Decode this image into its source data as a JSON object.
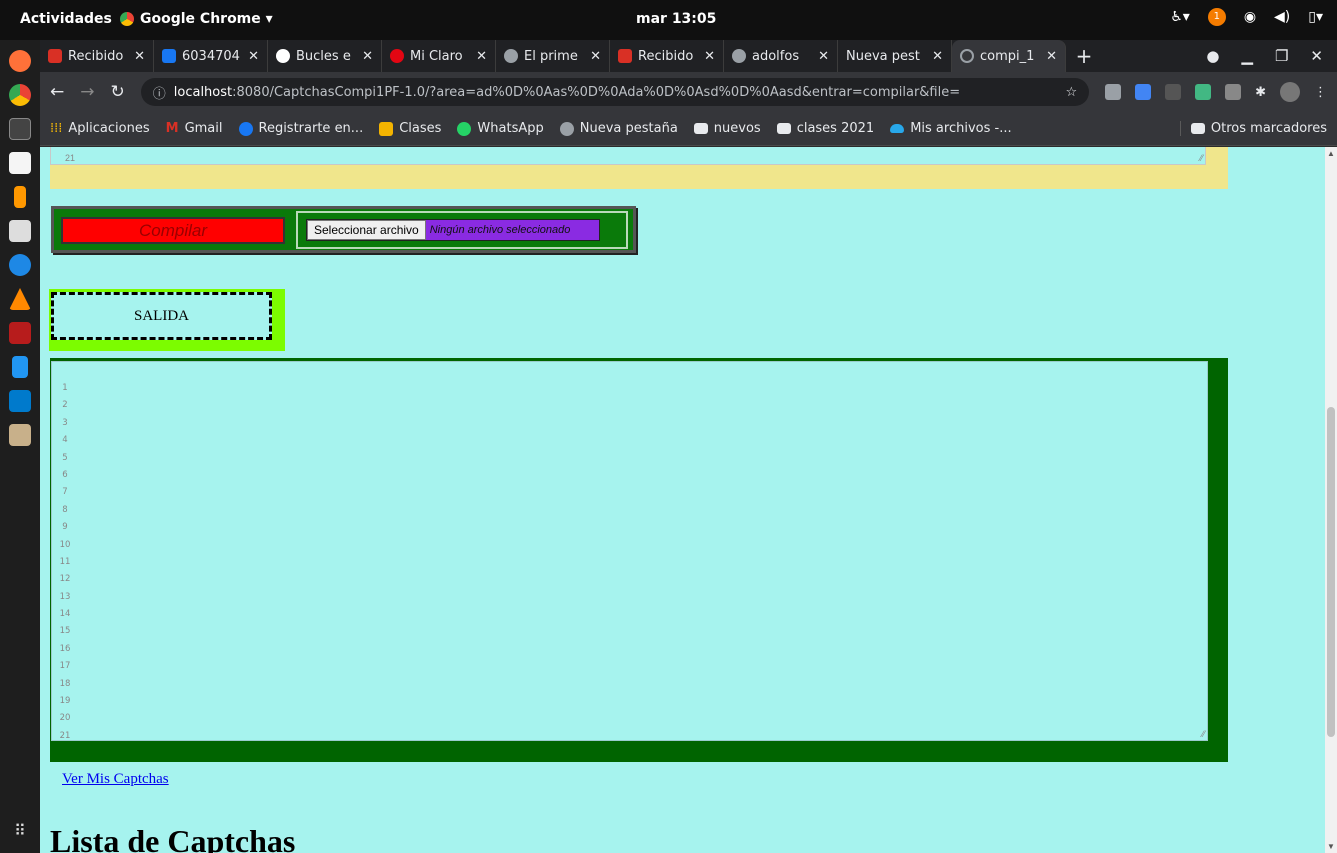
{
  "system": {
    "activities": "Actividades",
    "app_name": "Google Chrome ▾",
    "clock": "mar 13:05",
    "notification_count": "1"
  },
  "tabs": [
    {
      "label": "Recibido",
      "icon": "gmail-icon",
      "color": "#d93025"
    },
    {
      "label": "6034704",
      "icon": "facebook-icon",
      "color": "#1877f2"
    },
    {
      "label": "Bucles e",
      "icon": "pin-icon",
      "color": "#ffffff"
    },
    {
      "label": "Mi Claro",
      "icon": "claro-icon",
      "color": "#e30613"
    },
    {
      "label": "El prime",
      "icon": "globe-icon",
      "color": "#9aa0a6"
    },
    {
      "label": "Recibido",
      "icon": "gmail-icon",
      "color": "#d93025"
    },
    {
      "label": "adolfos",
      "icon": "github-icon",
      "color": "#9aa0a6"
    },
    {
      "label": "Nueva pest",
      "icon": "",
      "color": ""
    },
    {
      "label": "compi_1",
      "icon": "loading-icon",
      "color": "#9aa0a6",
      "active": true
    }
  ],
  "address": {
    "host": "localhost",
    "path": ":8080/CaptchasCompi1PF-1.0/?area=ad%0D%0Aas%0D%0Ada%0D%0Asd%0D%0Aasd&entrar=compilar&file="
  },
  "bookmarks": [
    {
      "label": "Aplicaciones",
      "icon": "apps-icon",
      "color": "#fbbc04"
    },
    {
      "label": "Gmail",
      "icon": "gmail-icon",
      "color": "#d93025"
    },
    {
      "label": "Registrarte en...",
      "icon": "facebook-icon",
      "color": "#1877f2"
    },
    {
      "label": "Clases",
      "icon": "classroom-icon",
      "color": "#f4b400"
    },
    {
      "label": "WhatsApp",
      "icon": "whatsapp-icon",
      "color": "#25d366"
    },
    {
      "label": "Nueva pestaña",
      "icon": "globe-icon",
      "color": "#9aa0a6"
    },
    {
      "label": "nuevos",
      "icon": "folder-icon",
      "color": "#e8eaed"
    },
    {
      "label": "clases 2021",
      "icon": "folder-icon",
      "color": "#e8eaed"
    },
    {
      "label": "Mis archivos -...",
      "icon": "onedrive-icon",
      "color": "#28a8ea"
    }
  ],
  "other_bookmarks": "Otros marcadores",
  "page": {
    "top_area_last_line": "21",
    "compile_button": "Compilar",
    "file_button": "Seleccionar archivo",
    "file_status": "Ningún archivo seleccionado",
    "salida": "SALIDA",
    "output_lines": [
      "1",
      "2",
      "3",
      "4",
      "5",
      "6",
      "7",
      "8",
      "9",
      "10",
      "11",
      "12",
      "13",
      "14",
      "15",
      "16",
      "17",
      "18",
      "19",
      "20",
      "21"
    ],
    "captchas_link": "Ver Mis Captchas",
    "list_title": "Lista de Captchas"
  },
  "colors": {
    "page_bg": "#a6f3ee",
    "compile_red": "#ff0000",
    "form_green": "#0a7a0a",
    "salida_lime": "#7cfc00",
    "output_green": "#006400",
    "file_status_purple": "#8a2be2"
  }
}
